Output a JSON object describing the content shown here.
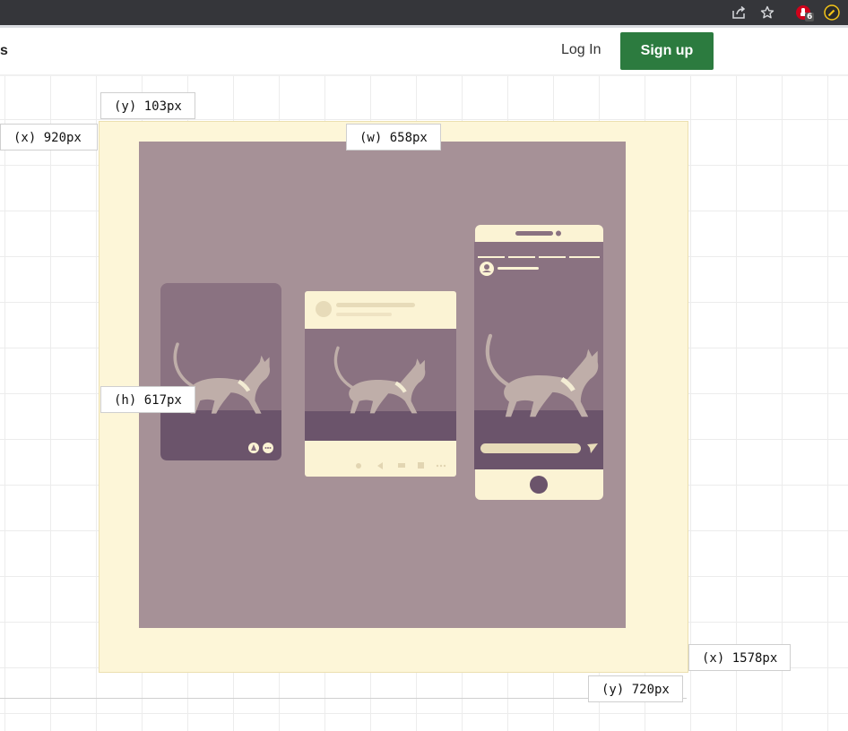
{
  "browser": {
    "icons": [
      "share-icon",
      "star-icon",
      "extension-icon",
      "pencil-icon"
    ],
    "extension_badge": "6",
    "colors": {
      "bar": "#35363a",
      "extension": "#d0021b",
      "pencil": "#f5c518"
    }
  },
  "header": {
    "nav_partial": "s",
    "login_label": "Log In",
    "signup_label": "Sign up",
    "colors": {
      "signup_bg": "#2c7b3f"
    }
  },
  "measurements": {
    "y_top": "(y) 103px",
    "x_left": "(x) 920px",
    "width": "(w) 658px",
    "height": "(h) 617px",
    "x_right": "(x) 1578px",
    "y_bottom": "(y) 720px"
  },
  "illustration": {
    "subject": "cat",
    "frames": [
      "story-card",
      "post-card",
      "phone"
    ],
    "colors": {
      "canvas": "#fdf6d8",
      "backdrop": "#a69197",
      "frame": "#8a7281",
      "floor": "#6b546b",
      "cat": "#bfaea9",
      "cream": "#fbf3d4"
    }
  }
}
